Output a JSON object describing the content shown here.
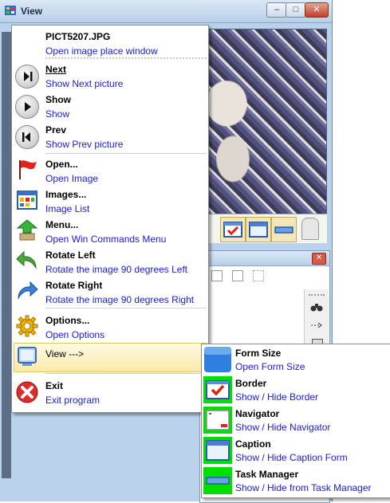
{
  "window": {
    "title": "View",
    "minimize_glyph": "–",
    "maximize_glyph": "□",
    "close_glyph": "✕",
    "panel_close_glyph": "✕"
  },
  "menu": {
    "header": {
      "title": "PICT5207.JPG",
      "subtitle": "Open image place window"
    },
    "items": [
      {
        "key": "next",
        "title": "Next",
        "subtitle": "Show Next picture",
        "icon": "next-track-icon"
      },
      {
        "key": "show",
        "title": "Show",
        "subtitle": "Show",
        "icon": "play-icon"
      },
      {
        "key": "prev",
        "title": "Prev",
        "subtitle": "Show Prev picture",
        "icon": "previous-track-icon"
      },
      {
        "key": "open",
        "title": "Open...",
        "subtitle": "Open Image",
        "icon": "red-flag-icon"
      },
      {
        "key": "images",
        "title": "Images...",
        "subtitle": "Image List",
        "icon": "image-list-icon"
      },
      {
        "key": "menu",
        "title": "Menu...",
        "subtitle": "Open Win Commands Menu",
        "icon": "green-arrows-icon"
      },
      {
        "key": "rotate_left",
        "title": "Rotate Left",
        "subtitle": "Rotate the image 90 degrees Left",
        "icon": "rotate-left-icon"
      },
      {
        "key": "rotate_right",
        "title": "Rotate Right",
        "subtitle": "Rotate the image 90 degrees Right",
        "icon": "rotate-right-icon"
      },
      {
        "key": "options",
        "title": "Options...",
        "subtitle": "Open Options",
        "icon": "gear-icon"
      },
      {
        "key": "view",
        "title": "View --->",
        "icon": "monitor-icon"
      },
      {
        "key": "exit",
        "title": "Exit",
        "subtitle": "Exit program",
        "icon": "close-circle-icon"
      }
    ]
  },
  "submenu": {
    "items": [
      {
        "key": "form_size",
        "title": "Form Size",
        "subtitle": "Open Form Size",
        "icon": "form-size-icon"
      },
      {
        "key": "border",
        "title": "Border",
        "subtitle": "Show / Hide Border",
        "icon": "border-check-icon"
      },
      {
        "key": "navigator",
        "title": "Navigator",
        "subtitle": "Show / Hide Navigator",
        "icon": "navigator-icon"
      },
      {
        "key": "caption",
        "title": "Caption",
        "subtitle": "Show / Hide Caption Form",
        "icon": "caption-icon"
      },
      {
        "key": "task_manager",
        "title": "Task Manager",
        "subtitle": "Show / Hide from Task Manager",
        "icon": "taskbar-icon"
      }
    ]
  },
  "colors": {
    "subtitle_blue": "#1a1ae0",
    "submenu_icon_bg": "#00e000",
    "highlight": "#fbe9a9"
  }
}
